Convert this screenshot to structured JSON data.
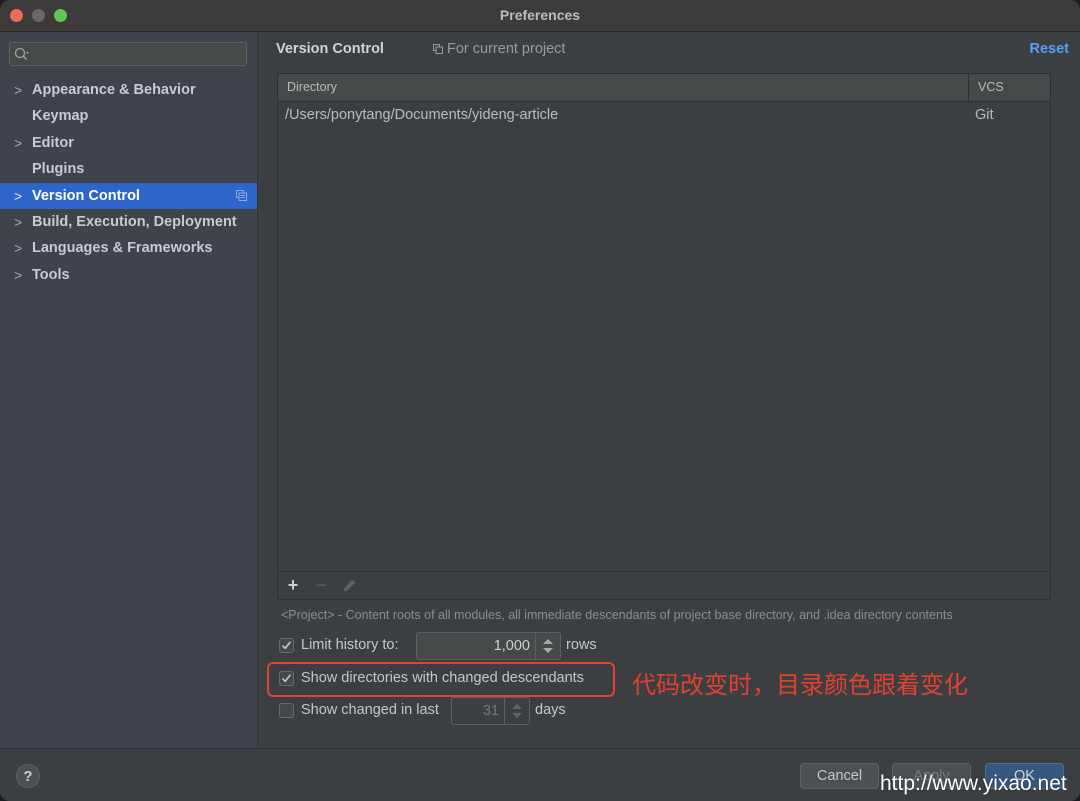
{
  "window": {
    "title": "Preferences"
  },
  "sidebar": {
    "search": {
      "placeholder": "",
      "value": ""
    },
    "items": [
      {
        "label": "Appearance & Behavior",
        "expandable": true,
        "selected": false
      },
      {
        "label": "Keymap",
        "expandable": false,
        "selected": false
      },
      {
        "label": "Editor",
        "expandable": true,
        "selected": false
      },
      {
        "label": "Plugins",
        "expandable": false,
        "selected": false
      },
      {
        "label": "Version Control",
        "expandable": true,
        "selected": true
      },
      {
        "label": "Build, Execution, Deployment",
        "expandable": true,
        "selected": false
      },
      {
        "label": "Languages & Frameworks",
        "expandable": true,
        "selected": false
      },
      {
        "label": "Tools",
        "expandable": true,
        "selected": false
      }
    ],
    "chevron_glyph": ">"
  },
  "header": {
    "title": "Version Control",
    "scope_label": "For current project",
    "reset_label": "Reset"
  },
  "table": {
    "columns": [
      "Directory",
      "VCS"
    ],
    "rows": [
      {
        "directory": "/Users/ponytang/Documents/yideng-article",
        "vcs": "Git"
      }
    ],
    "toolbar": {
      "add": "+",
      "remove": "−"
    }
  },
  "hint": "<Project> - Content roots of all modules, all immediate descendants of project base directory, and .idea directory contents",
  "options": {
    "limit_history": {
      "label": "Limit history to:",
      "checked": true,
      "value": "1,000",
      "suffix": "rows"
    },
    "show_dirs_changed": {
      "label": "Show directories with changed descendants",
      "checked": true
    },
    "show_changed_last": {
      "label": "Show changed in last",
      "checked": false,
      "value": "31",
      "suffix": "days"
    }
  },
  "annotation": {
    "text": "代码改变时，目录颜色跟着变化",
    "color": "#e2412e"
  },
  "footer": {
    "help_label": "?",
    "cancel_label": "Cancel",
    "apply_label": "Apply",
    "ok_label": "OK"
  },
  "watermark": "http://www.yixao.net",
  "colors": {
    "selection": "#2f65ca",
    "link": "#589df6",
    "annotation": "#e2412e"
  }
}
